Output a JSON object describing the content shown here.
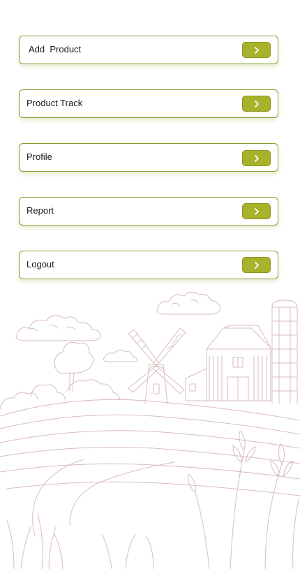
{
  "menu": {
    "items": [
      {
        "label": "Add  Product",
        "icon": "chevron-right-icon"
      },
      {
        "label": "Product Track",
        "icon": "chevron-right-icon"
      },
      {
        "label": "Profile",
        "icon": "chevron-right-icon"
      },
      {
        "label": "Report",
        "icon": "chevron-right-icon"
      },
      {
        "label": "Logout",
        "icon": "chevron-right-icon"
      }
    ]
  },
  "colors": {
    "accent": "#a8b22a",
    "border": "#8a9a2a",
    "illustration": "#d9bcbc"
  },
  "illustration": {
    "subject": "farm-landscape-illustration"
  }
}
